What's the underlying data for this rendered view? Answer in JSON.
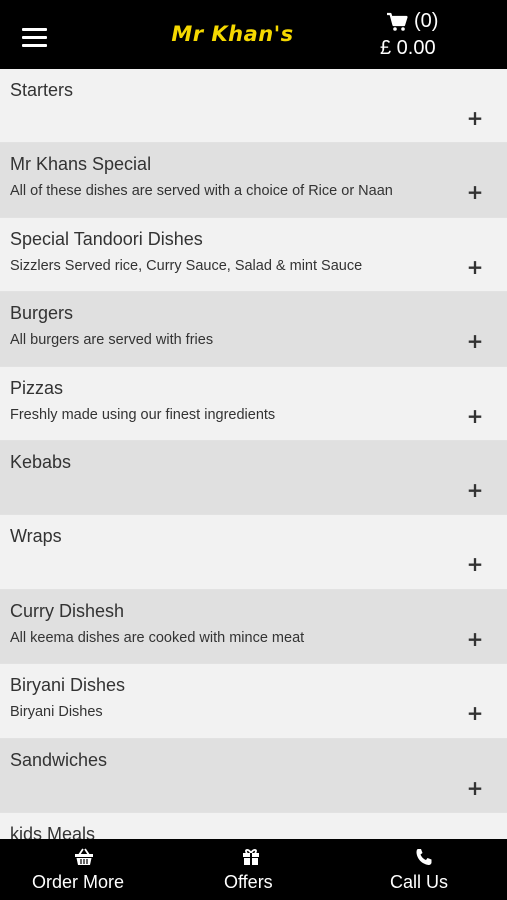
{
  "header": {
    "logo_text": "Mr Khan's",
    "cart_count": "(0)",
    "cart_total": "£ 0.00",
    "logo_color": "#f5d800"
  },
  "menu": {
    "items": [
      {
        "title": "Starters",
        "desc": ""
      },
      {
        "title": "Mr Khans Special",
        "desc": "All of these dishes are served with a choice of Rice or Naan"
      },
      {
        "title": "Special Tandoori Dishes",
        "desc": "Sizzlers Served rice, Curry Sauce, Salad & mint Sauce"
      },
      {
        "title": "Burgers",
        "desc": "All burgers are served with fries"
      },
      {
        "title": "Pizzas",
        "desc": "Freshly made using our finest ingredients"
      },
      {
        "title": "Kebabs",
        "desc": ""
      },
      {
        "title": "Wraps",
        "desc": ""
      },
      {
        "title": "Curry Dishesh",
        "desc": "All keema dishes are cooked with mince meat"
      },
      {
        "title": "Biryani Dishes",
        "desc": "Biryani Dishes"
      },
      {
        "title": "Sandwiches",
        "desc": ""
      },
      {
        "title": "kids Meals",
        "desc": ""
      }
    ],
    "expand_symbol": "+"
  },
  "footer": {
    "order_more": "Order More",
    "offers": "Offers",
    "call_us": "Call Us",
    "icons": [
      "basket-icon",
      "gift-icon",
      "phone-icon"
    ]
  }
}
